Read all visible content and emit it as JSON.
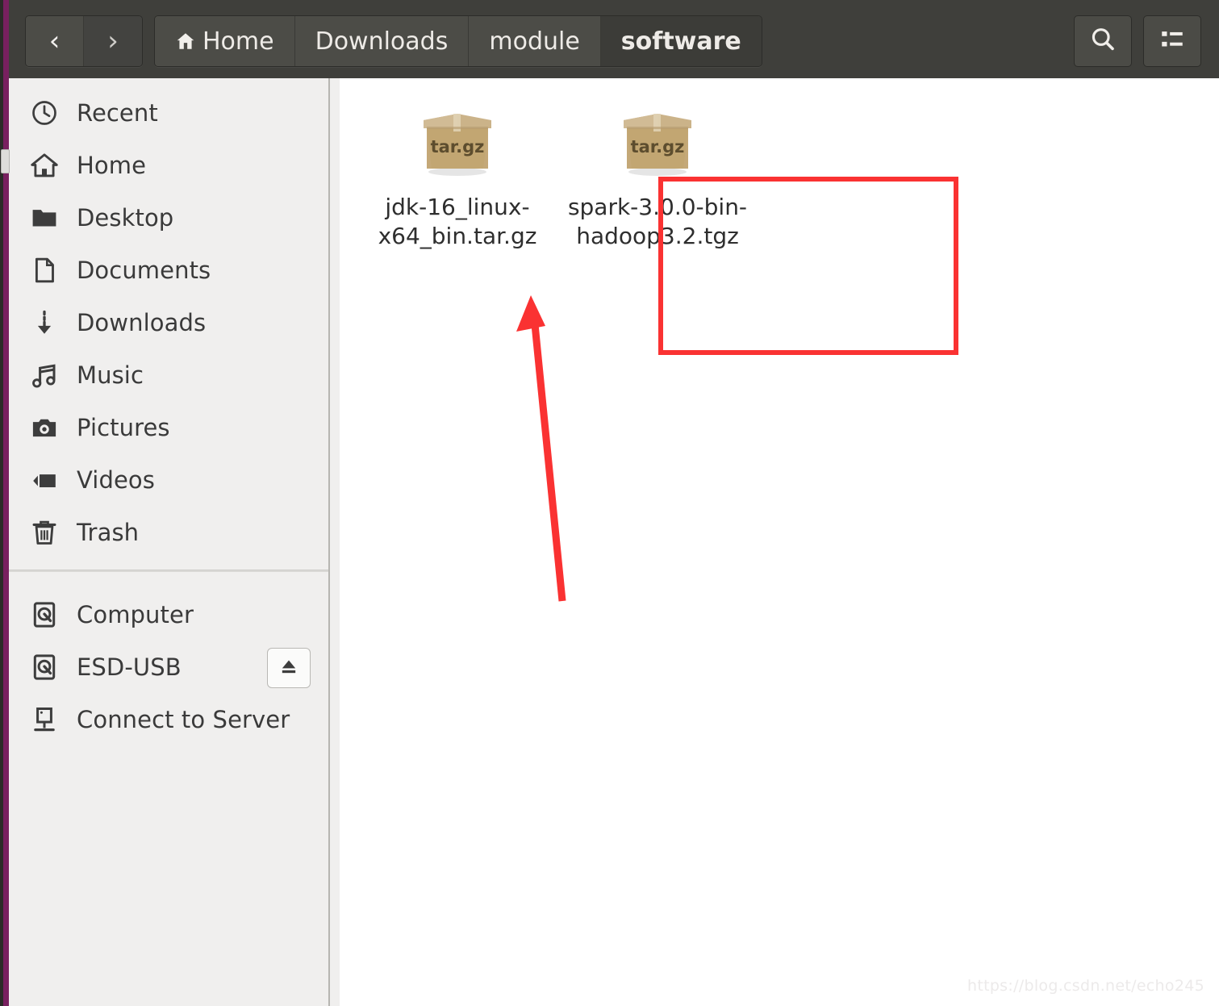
{
  "window": {
    "title": "software",
    "desktop_accent_color": "#78205f",
    "toolbar_bg": "#3f3f3b",
    "sidebar_bg": "#f0efee",
    "content_bg": "#ffffff"
  },
  "toolbar": {
    "back_label": "‹",
    "forward_label": "›",
    "breadcrumbs": [
      {
        "label": "Home",
        "icon": "home-icon",
        "current": false
      },
      {
        "label": "Downloads",
        "icon": "",
        "current": false
      },
      {
        "label": "module",
        "icon": "",
        "current": false
      },
      {
        "label": "software",
        "icon": "",
        "current": true
      }
    ],
    "search_icon": "search-icon",
    "view_options_icon": "list-view-icon"
  },
  "sidebar": {
    "places": [
      {
        "label": "Recent",
        "icon": "clock-icon"
      },
      {
        "label": "Home",
        "icon": "home-icon"
      },
      {
        "label": "Desktop",
        "icon": "folder-icon"
      },
      {
        "label": "Documents",
        "icon": "document-icon"
      },
      {
        "label": "Downloads",
        "icon": "download-arrow-icon"
      },
      {
        "label": "Music",
        "icon": "music-note-icon"
      },
      {
        "label": "Pictures",
        "icon": "camera-icon"
      },
      {
        "label": "Videos",
        "icon": "video-camera-icon"
      },
      {
        "label": "Trash",
        "icon": "trash-icon"
      }
    ],
    "devices": [
      {
        "label": "Computer",
        "icon": "hard-drive-icon",
        "eject": false
      },
      {
        "label": "ESD-USB",
        "icon": "hard-drive-icon",
        "eject": true
      },
      {
        "label": "Connect to Server",
        "icon": "server-icon",
        "eject": false
      }
    ],
    "eject_icon": "eject-icon"
  },
  "files": [
    {
      "name": "jdk-16_linux-x64_bin.tar.gz",
      "icon": "archive-tar-gz-icon",
      "badge": "tar.gz",
      "highlighted": true
    },
    {
      "name": "spark-3.0.0-bin-hadoop3.2.tgz",
      "icon": "archive-tar-gz-icon",
      "badge": "tar.gz",
      "highlighted": false
    }
  ],
  "annotations": {
    "highlight_color": "#fa3232",
    "arrow_color": "#fa3232",
    "arrow_points_to": "jdk-16_linux-x64_bin.tar.gz"
  },
  "watermark": {
    "text": "https://blog.csdn.net/echo245"
  }
}
